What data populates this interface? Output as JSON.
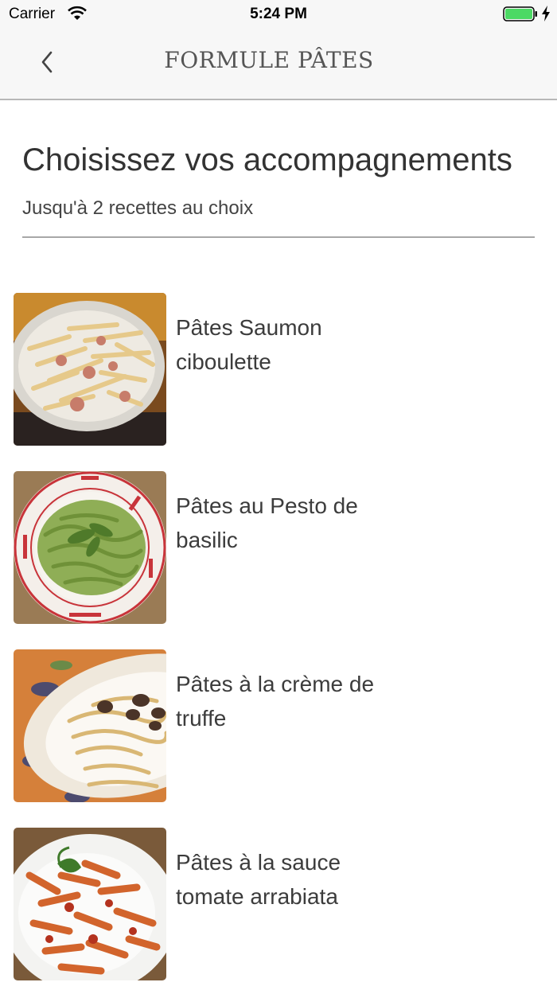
{
  "status_bar": {
    "carrier": "Carrier",
    "time": "5:24 PM",
    "battery_color": "#4cd964"
  },
  "nav": {
    "title": "FORMULE PÂTES",
    "back_icon": "chevron-left-icon"
  },
  "header": {
    "title": "Choisissez vos accompagnements",
    "subtitle": "Jusqu'à 2 recettes au choix"
  },
  "recipes": [
    {
      "name": "Pâtes Saumon ciboulette"
    },
    {
      "name": "Pâtes au Pesto de basilic"
    },
    {
      "name": "Pâtes à la crème de truffe"
    },
    {
      "name": "Pâtes à la sauce tomate arrabiata"
    }
  ]
}
